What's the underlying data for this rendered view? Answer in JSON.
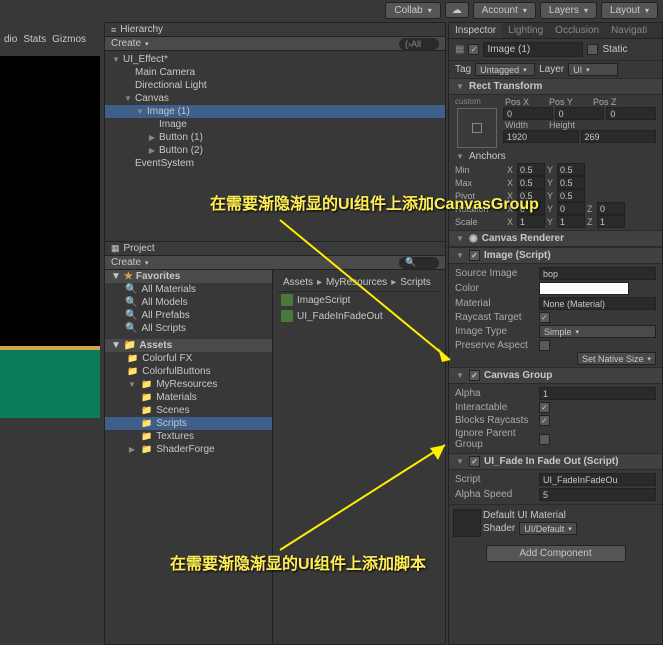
{
  "toolbar": {
    "collab": "Collab",
    "account": "Account",
    "layers": "Layers",
    "layout": "Layout"
  },
  "leftStrip": {
    "a": "dio",
    "b": "Stats",
    "c": "Gizmos"
  },
  "hierarchy": {
    "title": "Hierarchy",
    "create": "Create",
    "search": "(›All",
    "items": [
      {
        "name": "UI_Effect*",
        "indent": 0,
        "fold": "▼"
      },
      {
        "name": "Main Camera",
        "indent": 1
      },
      {
        "name": "Directional Light",
        "indent": 1
      },
      {
        "name": "Canvas",
        "indent": 1,
        "fold": "▼"
      },
      {
        "name": "Image (1)",
        "indent": 2,
        "fold": "▼",
        "sel": true
      },
      {
        "name": "Image",
        "indent": 3
      },
      {
        "name": "Button (1)",
        "indent": 3,
        "fold": "▶"
      },
      {
        "name": "Button (2)",
        "indent": 3,
        "fold": "▶"
      },
      {
        "name": "EventSystem",
        "indent": 1
      }
    ]
  },
  "project": {
    "title": "Project",
    "create": "Create",
    "breadcrumb": [
      "Assets",
      "MyResources",
      "Scripts"
    ],
    "favorites": "Favorites",
    "favItems": [
      "All Materials",
      "All Models",
      "All Prefabs",
      "All Scripts"
    ],
    "assets": "Assets",
    "tree": [
      {
        "name": "Colorful FX",
        "indent": 1
      },
      {
        "name": "ColorfulButtons",
        "indent": 1
      },
      {
        "name": "MyResources",
        "indent": 1,
        "fold": "▼"
      },
      {
        "name": "Materials",
        "indent": 2
      },
      {
        "name": "Scenes",
        "indent": 2
      },
      {
        "name": "Scripts",
        "indent": 2,
        "sel": true
      },
      {
        "name": "Textures",
        "indent": 2
      },
      {
        "name": "ShaderForge",
        "indent": 1,
        "fold": "▶"
      }
    ],
    "files": [
      "ImageScript",
      "UI_FadeInFadeOut"
    ]
  },
  "inspector": {
    "tabs": [
      "Inspector",
      "Lighting",
      "Occlusion",
      "Navigati"
    ],
    "name": "Image (1)",
    "static": "Static",
    "tag": "Tag",
    "tagVal": "Untagged",
    "layer": "Layer",
    "layerVal": "UI",
    "rect": {
      "title": "Rect Transform",
      "custom": "custom",
      "posX": "Pos X",
      "posY": "Pos Y",
      "posZ": "Pos Z",
      "px": "0",
      "py": "0",
      "pz": "0",
      "width": "Width",
      "height": "Height",
      "w": "1920",
      "h": "269"
    },
    "anchors": {
      "title": "Anchors",
      "min": "Min",
      "max": "Max",
      "pivot": "Pivot",
      "minX": "0.5",
      "minY": "0.5",
      "maxX": "0.5",
      "maxY": "0.5",
      "pivX": "0.5",
      "pivY": "0.5",
      "rotation": "Rotation",
      "scale": "Scale",
      "rx": "0",
      "ry": "0",
      "rz": "0",
      "sx": "1",
      "sy": "1",
      "sz": "1"
    },
    "canvasRenderer": "Canvas Renderer",
    "image": {
      "title": "Image (Script)",
      "sourceImage": "Source Image",
      "sourceVal": "bop",
      "color": "Color",
      "material": "Material",
      "matVal": "None (Material)",
      "raycast": "Raycast Target",
      "imageType": "Image Type",
      "typeVal": "Simple",
      "preserve": "Preserve Aspect",
      "setNative": "Set Native Size"
    },
    "canvasGroup": {
      "title": "Canvas Group",
      "alpha": "Alpha",
      "alphaVal": "1",
      "interactable": "Interactable",
      "blocks": "Blocks Raycasts",
      "ignore": "Ignore Parent Group"
    },
    "fade": {
      "title": "UI_Fade In Fade Out (Script)",
      "script": "Script",
      "scriptVal": "UI_FadeInFadeOu",
      "speed": "Alpha Speed",
      "speedVal": "5"
    },
    "mat": {
      "name": "Default UI Material",
      "shader": "Shader",
      "shaderVal": "UI/Default"
    },
    "addComp": "Add Component"
  },
  "annotations": {
    "a1": "在需要渐隐渐显的UI组件上添加CanvasGroup",
    "a2": "在需要渐隐渐显的UI组件上添加脚本"
  }
}
